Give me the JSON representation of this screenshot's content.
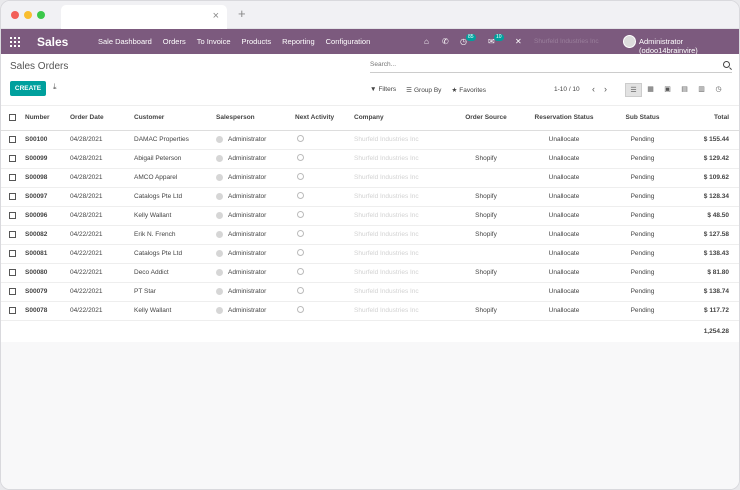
{
  "app": {
    "name": "Sales"
  },
  "menu": [
    "Sale Dashboard",
    "Orders",
    "To Invoice",
    "Products",
    "Reporting",
    "Configuration"
  ],
  "systray": {
    "activity_count": "85",
    "message_count": "10",
    "company": "Shurfeld Industries Inc",
    "user": "Administrator (odoo14brainvire)"
  },
  "page": {
    "title": "Sales Orders"
  },
  "search": {
    "placeholder": "Search..."
  },
  "toolbar": {
    "create_label": "CREATE",
    "filters_label": "Filters",
    "group_by_label": "Group By",
    "favorites_label": "Favorites",
    "pager": "1-10 / 10"
  },
  "table": {
    "columns": [
      "Number",
      "Order Date",
      "Customer",
      "Salesperson",
      "Next Activity",
      "Company",
      "Order Source",
      "Reservation Status",
      "Sub Status",
      "Total"
    ],
    "rows": [
      [
        "S00100",
        "04/28/2021",
        "DAMAC Properties",
        "Administrator",
        "Shurfeld Industries Inc",
        "",
        "Unallocate",
        "Pending",
        "$ 155.44"
      ],
      [
        "S00099",
        "04/28/2021",
        "Abigail Peterson",
        "Administrator",
        "Shurfeld Industries Inc",
        "Shopify",
        "Unallocate",
        "Pending",
        "$ 129.42"
      ],
      [
        "S00098",
        "04/28/2021",
        "AMCO Apparel",
        "Administrator",
        "Shurfeld Industries Inc",
        "",
        "Unallocate",
        "Pending",
        "$ 109.62"
      ],
      [
        "S00097",
        "04/28/2021",
        "Catalogs Pte Ltd",
        "Administrator",
        "Shurfeld Industries Inc",
        "Shopify",
        "Unallocate",
        "Pending",
        "$ 128.34"
      ],
      [
        "S00096",
        "04/28/2021",
        "Kelly Wallant",
        "Administrator",
        "Shurfeld Industries Inc",
        "Shopify",
        "Unallocate",
        "Pending",
        "$ 48.50"
      ],
      [
        "S00082",
        "04/22/2021",
        "Erik N. French",
        "Administrator",
        "Shurfeld Industries Inc",
        "Shopify",
        "Unallocate",
        "Pending",
        "$ 127.58"
      ],
      [
        "S00081",
        "04/22/2021",
        "Catalogs Pte Ltd",
        "Administrator",
        "Shurfeld Industries Inc",
        "",
        "Unallocate",
        "Pending",
        "$ 138.43"
      ],
      [
        "S00080",
        "04/22/2021",
        "Deco Addict",
        "Administrator",
        "Shurfeld Industries Inc",
        "Shopify",
        "Unallocate",
        "Pending",
        "$ 81.80"
      ],
      [
        "S00079",
        "04/22/2021",
        "PT Star",
        "Administrator",
        "Shurfeld Industries Inc",
        "",
        "Unallocate",
        "Pending",
        "$ 138.74"
      ],
      [
        "S00078",
        "04/22/2021",
        "Kelly Wallant",
        "Administrator",
        "Shurfeld Industries Inc",
        "Shopify",
        "Unallocate",
        "Pending",
        "$ 117.72"
      ]
    ],
    "grand_total": "1,254.28"
  },
  "colors": {
    "brand": "#7c5a7e",
    "accent": "#00a09d"
  }
}
